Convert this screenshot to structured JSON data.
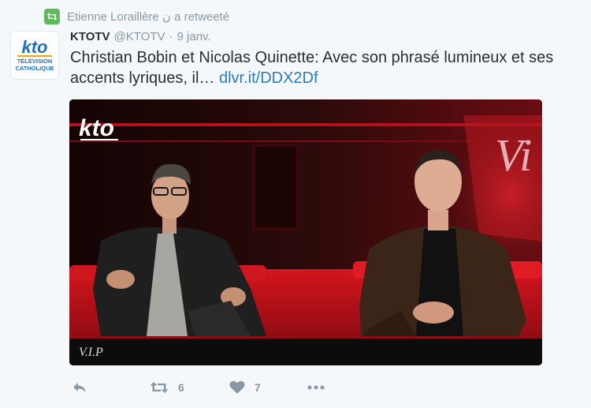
{
  "context": {
    "retweeter": "Etienne Loraillère ن a retweeté"
  },
  "author": {
    "name": "KTOTV",
    "handle": "@KTOTV",
    "separator": "·",
    "time": "9 janv."
  },
  "tweet": {
    "text": "Christian Bobin et Nicolas Quinette: Avec son phrasé lumineux et ses accents lyriques, il…",
    "link": "dlvr.it/DDX2Df"
  },
  "avatar_logo": {
    "mark": "kto",
    "line1": "TÉLÉVISION",
    "line2": "CATHOLIQUE"
  },
  "media": {
    "watermark": "kto",
    "caption": "V.I.P"
  },
  "actions": {
    "reply_icon": "reply-icon",
    "retweet_icon": "retweet-icon",
    "retweet_count": "6",
    "like_icon": "heart-icon",
    "like_count": "7",
    "more_icon": "more-icon"
  },
  "colors": {
    "background": "#f5f8fa",
    "text": "#292f33",
    "muted": "#8899a6",
    "link": "#2b7bb9",
    "retweet_badge": "#5fb85a",
    "brand_blue": "#1d6fb8",
    "set_red": "#b4121b"
  }
}
